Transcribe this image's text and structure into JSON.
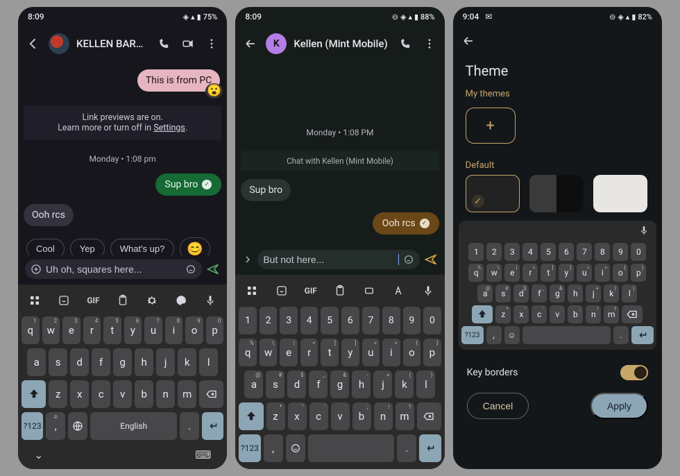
{
  "panel1": {
    "status": {
      "time": "8:09",
      "battery": "75%"
    },
    "header": {
      "title": "KELLEN BARR..."
    },
    "msg_pc": "This is from PC",
    "notice_line1": "Link previews are on.",
    "notice_line2a": "Learn more or turn off in ",
    "notice_link": "Settings",
    "date": "Monday • 1:08 pm",
    "msg_sup": "Sup bro",
    "msg_ooh": "Ooh rcs",
    "chips": {
      "c1": "Cool",
      "c2": "Yep",
      "c3": "What's up?",
      "emoji": "😊"
    },
    "composer": {
      "value": "Uh oh, squares here..."
    },
    "keyboard": {
      "space_label": "English",
      "sym": "?123",
      "gif": "GIF"
    }
  },
  "panel2": {
    "status": {
      "time": "8:09",
      "battery": "88%"
    },
    "header": {
      "title": "Kellen (Mint Mobile)",
      "avatar_letter": "K"
    },
    "date": "Monday • 1:08 PM",
    "divider": "Chat with Kellen (Mint Mobile)",
    "msg_sup": "Sup bro",
    "msg_ooh": "Ooh rcs",
    "composer": {
      "value": "But not here..."
    },
    "keyboard": {
      "sym": "?123",
      "gif": "GIF"
    }
  },
  "panel3": {
    "status": {
      "time": "9:04",
      "battery": "82%"
    },
    "title": "Theme",
    "my_themes": "My themes",
    "default": "Default",
    "keyboard": {
      "sym": "?123"
    },
    "key_borders": "Key borders",
    "cancel": "Cancel",
    "apply": "Apply"
  },
  "keys": {
    "row_num": [
      "1",
      "2",
      "3",
      "4",
      "5",
      "6",
      "7",
      "8",
      "9",
      "0"
    ],
    "row1": [
      "q",
      "w",
      "e",
      "r",
      "t",
      "y",
      "u",
      "i",
      "o",
      "p"
    ],
    "row2": [
      "a",
      "s",
      "d",
      "f",
      "g",
      "h",
      "j",
      "k",
      "l"
    ],
    "row3": [
      "z",
      "x",
      "c",
      "v",
      "b",
      "n",
      "m"
    ]
  }
}
